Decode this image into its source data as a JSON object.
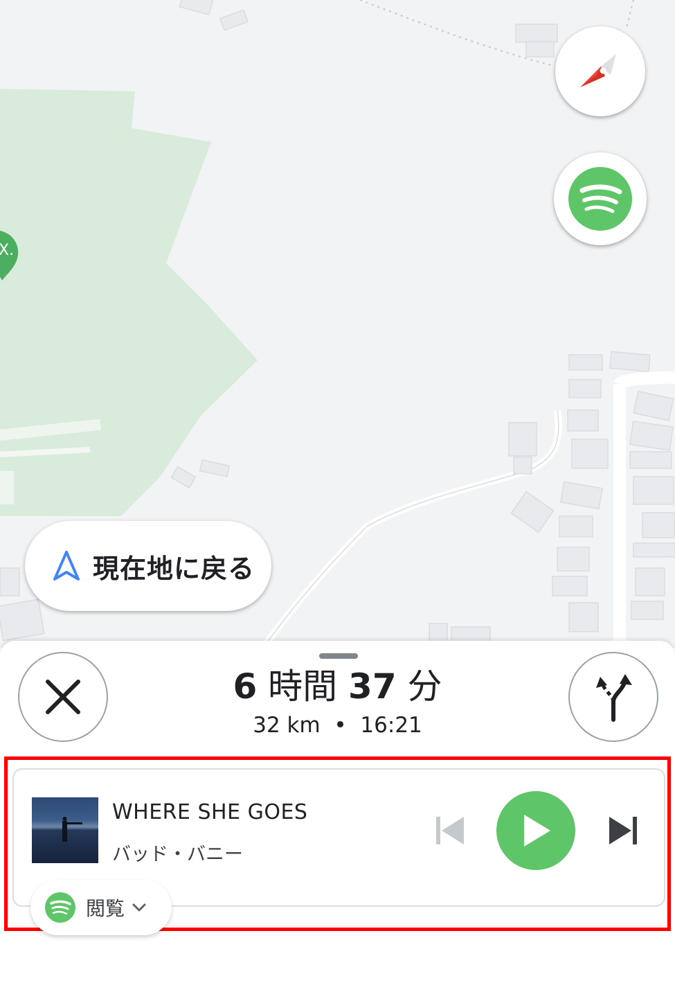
{
  "map": {
    "recenter_label": "現在地に戻る",
    "compass_icon": "compass-icon",
    "spotify_icon": "spotify-icon",
    "colors": {
      "land": "#f1f3f4",
      "park": "#d9ecdb",
      "road": "#ffffff",
      "building": "#e8eaed"
    }
  },
  "route": {
    "hours_value": "6",
    "hours_unit": "時間",
    "minutes_value": "37",
    "minutes_unit": "分",
    "distance": "32 km",
    "separator": "•",
    "arrival_time": "16:21"
  },
  "player": {
    "track_title": "WHERE SHE GOES",
    "artist": "バッド・バニー",
    "source_label": "閲覧",
    "accent": "#5fc569",
    "icons": [
      "previous-icon",
      "play-icon",
      "next-icon",
      "spotify-icon",
      "chevron-down-icon"
    ]
  }
}
